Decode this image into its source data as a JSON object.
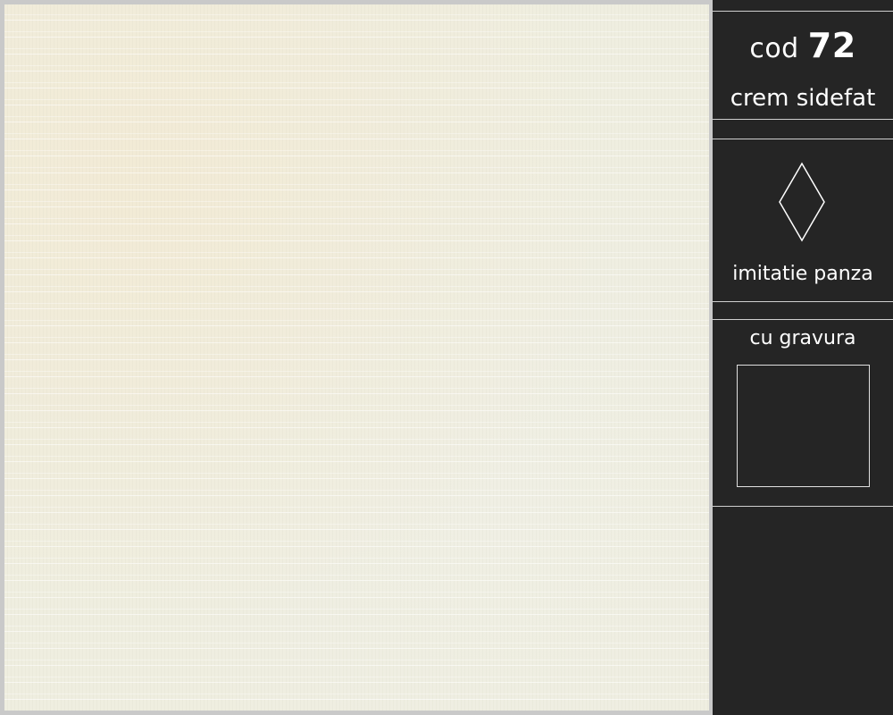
{
  "product": {
    "code_prefix": "cod",
    "code_number": "72",
    "color_name": "crem sidefat",
    "finish_label": "imitatie panza",
    "finish_icon": "diamond-icon",
    "engraving_label": "cu gravura"
  },
  "colors": {
    "swatch": "#efeee0",
    "sidebar_background": "#252525",
    "text": "#ffffff"
  }
}
